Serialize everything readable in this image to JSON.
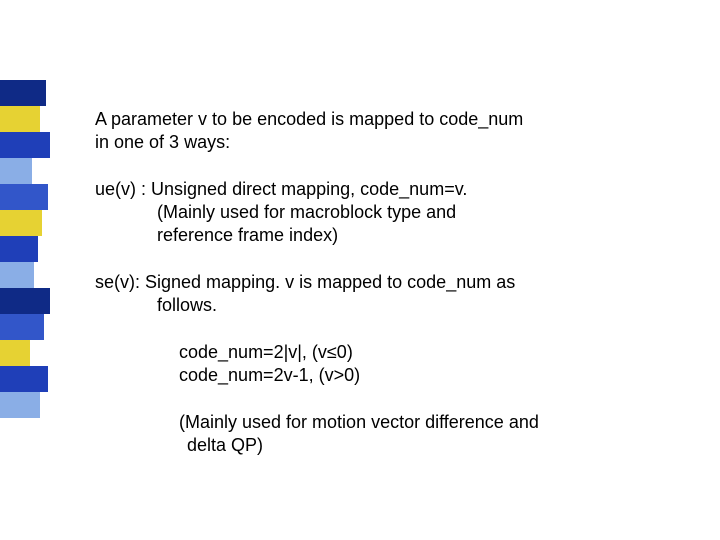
{
  "sidebar": {
    "bars": [
      {
        "w": 46,
        "color": "#0f2a86"
      },
      {
        "w": 40,
        "color": "#e6d233"
      },
      {
        "w": 50,
        "color": "#1f3fb8"
      },
      {
        "w": 32,
        "color": "#8aaee6"
      },
      {
        "w": 48,
        "color": "#3256c9"
      },
      {
        "w": 42,
        "color": "#e6d233"
      },
      {
        "w": 38,
        "color": "#1f3fb8"
      },
      {
        "w": 34,
        "color": "#8aaee6"
      },
      {
        "w": 50,
        "color": "#0f2a86"
      },
      {
        "w": 44,
        "color": "#3256c9"
      },
      {
        "w": 30,
        "color": "#e6d233"
      },
      {
        "w": 48,
        "color": "#1f3fb8"
      },
      {
        "w": 40,
        "color": "#8aaee6"
      }
    ]
  },
  "text": {
    "p1a": "A parameter v to be encoded is mapped to code_num",
    "p1b": " in one of 3 ways:",
    "p2a": "ue(v) : Unsigned direct mapping, code_num=v.",
    "p2b": "(Mainly used for macroblock type and",
    "p2c": " reference frame index)",
    "p3a": "se(v): Signed mapping. v is mapped to code_num as",
    "p3b": "follows.",
    "p4a": "code_num=2|v|, (v≤0)",
    "p4b": "code_num=2v-1, (v>0)",
    "p5a": "(Mainly used for motion vector difference and",
    "p5b": " delta QP)"
  }
}
